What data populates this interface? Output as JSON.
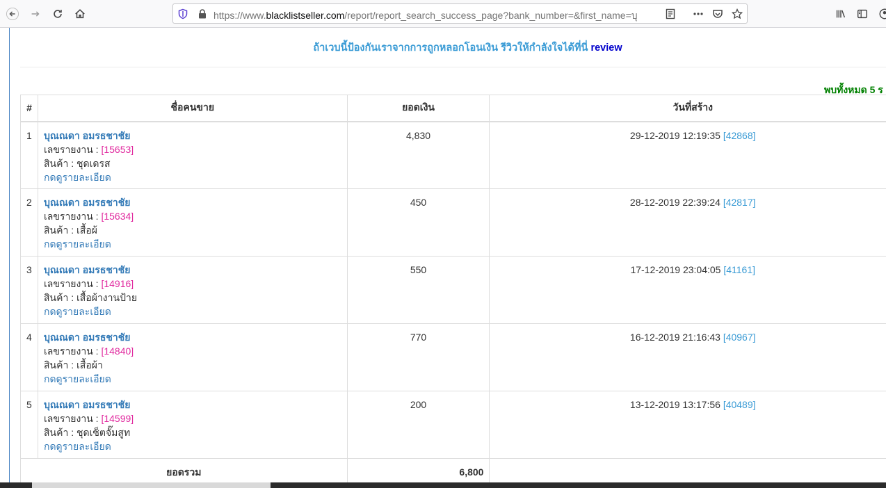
{
  "browser": {
    "url_prefix": "https://www.",
    "url_domain": "blacklistseller.com",
    "url_rest": "/report/report_search_success_page?bank_number=&first_name=บุณ"
  },
  "page": {
    "tagline_main": "ถ้าเวบนี้ป้องกันเราจากการถูกหลอกโอนเงิน รีวิวให้กำลังใจได้ที่นี่",
    "tagline_link": "review",
    "found_text": "พบทั้งหมด 5 ร"
  },
  "table": {
    "headers": [
      "#",
      "ชื่อคนขาย",
      "ยอดเงิน",
      "วันที่สร้าง"
    ],
    "report_label": "เลขรายงาน :",
    "product_label": "สินค้า :",
    "detail_link": "กดดูรายละเอียด",
    "rows": [
      {
        "no": "1",
        "seller": "บุณณดา อมรธชาชัย",
        "report": "[15653]",
        "product": "ชุดเดรส",
        "amount": "4,830",
        "date": "29-12-2019 12:19:35",
        "id": "[42868]"
      },
      {
        "no": "2",
        "seller": "บุณณดา อมรธชาชัย",
        "report": "[15634]",
        "product": "เสื้อผ้",
        "amount": "450",
        "date": "28-12-2019 22:39:24",
        "id": "[42817]"
      },
      {
        "no": "3",
        "seller": "บุณณดา อมรธชาชัย",
        "report": "[14916]",
        "product": "เสื้อผ้างานป้าย",
        "amount": "550",
        "date": "17-12-2019 23:04:05",
        "id": "[41161]"
      },
      {
        "no": "4",
        "seller": "บุณณดา อมรธชาชัย",
        "report": "[14840]",
        "product": "เสื้อผ้า",
        "amount": "770",
        "date": "16-12-2019 21:16:43",
        "id": "[40967]"
      },
      {
        "no": "5",
        "seller": "บุณณดา อมรธชาชัย",
        "report": "[14599]",
        "product": "ชุดเซ็ตจั๊มสูท",
        "amount": "200",
        "date": "13-12-2019 13:17:56",
        "id": "[40489]"
      }
    ],
    "total_label": "ยอดรวม",
    "total_value": "6,800"
  }
}
